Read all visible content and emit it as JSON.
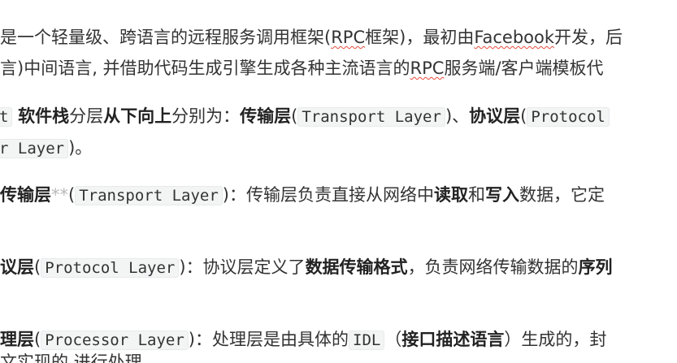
{
  "doc": {
    "p1": {
      "l1a": "是一个轻量级、跨语言的远程服务调用框架(",
      "rpc_a": "RPC",
      "l1b": "框架)，最初由",
      "facebook": "Facebook",
      "l1c": "开发，后",
      "l2a": "言)中间语言, 并借助代码生成引擎生成各种主流语言的",
      "rpc_b": "RPC",
      "l2b": "服务端/客户端模板代"
    },
    "p2": {
      "lead_code": "t",
      "software_stack": "软件栈",
      "layered": "分层",
      "bottom_up": "从下向上",
      "are": "分别为：",
      "transport_bold": "传输层",
      "paren_open": "(",
      "transport_code": "Transport Layer",
      "paren_close_sep": ")、",
      "protocol_bold": "协议层",
      "paren_open2": "(",
      "protocol_code": "Protocol",
      "l2_code": "r Layer",
      "l2_tail": ")。"
    },
    "p3": {
      "bold": "传输层",
      "stars": "**",
      "paren_open": "(",
      "code": "Transport Layer",
      "paren_close": ")",
      "text1": "：传输层负责直接从网络中",
      "read": "读取",
      "and": "和",
      "write": "写入",
      "text2": "数据，它定"
    },
    "p4": {
      "bold": "议层",
      "paren_open": "(",
      "code": "Protocol Layer",
      "paren_close": ")",
      "text1": "：协议层定义了",
      "format": "数据传输格式",
      "text2": "，负责网络传输数据的",
      "serial": "序列"
    },
    "p5": {
      "bold": "理层",
      "paren_open": "(",
      "code": "Processor Layer",
      "paren_close": ")",
      "text1": "：处理层是由具体的",
      "idl": "IDL",
      "text2": "（",
      "idl_desc": "接口描述语言",
      "text3": "）生成的，封",
      "partial": "文实现的                进行处理"
    }
  }
}
